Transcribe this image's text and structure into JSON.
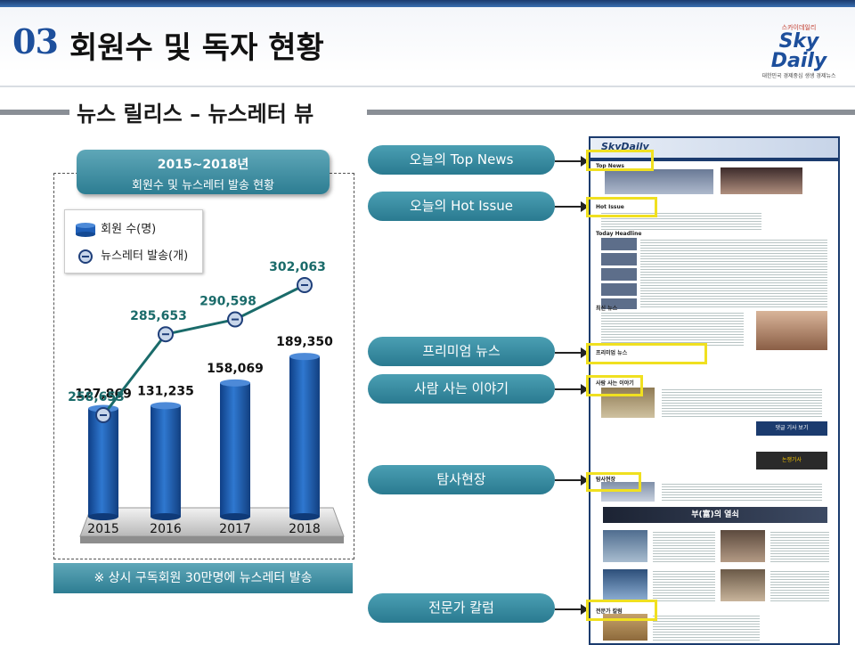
{
  "header": {
    "section_number": "03",
    "title": "회원수 및 독자 현황",
    "logo": {
      "small_text": "스카이데일리",
      "brand": "Sky Daily",
      "tagline": "대한민국 경제중심 생생 경제뉴스"
    }
  },
  "subtitle": "뉴스 릴리스 – 뉴스레터 뷰",
  "chart_panel": {
    "head_line1": "2015~2018년",
    "head_line2": "회원수 및 뉴스레터 발송 현황",
    "footnote": "※ 상시 구독회원  30만명에 뉴스레터 발송"
  },
  "chart_data": {
    "type": "bar",
    "categories": [
      "2015",
      "2016",
      "2017",
      "2018"
    ],
    "series": [
      {
        "name": "회원 수(명)",
        "type": "bar",
        "values": [
          127869,
          131235,
          158069,
          189350
        ],
        "labels": [
          "127,869",
          "131,235",
          "158,069",
          "189,350"
        ],
        "color": "#1f5fb8"
      },
      {
        "name": "뉴스레터 발송(개)",
        "type": "line",
        "values": [
          258653,
          285653,
          290598,
          302063
        ],
        "labels": [
          "258,653",
          "285,653",
          "290,598",
          "302,063"
        ],
        "color": "#1a6b6a"
      }
    ],
    "legend_position": "top-left",
    "grid": false,
    "colors": {
      "label_blue": "#1f5fb8",
      "label_teal": "#1a6b6a"
    }
  },
  "callouts": [
    {
      "label": "오늘의 Top News"
    },
    {
      "label": "오늘의  Hot Issue"
    },
    {
      "label": "프리미엄 뉴스"
    },
    {
      "label": "사람 사는 이야기"
    },
    {
      "label": "탐사현장"
    },
    {
      "label": "전문가 칼럼"
    }
  ],
  "newsletter": {
    "brand": "SkyDaily",
    "sections": [
      "Top News",
      "Hot Issue",
      "Today Headline",
      "최신 뉴스",
      "프리미엄 뉴스",
      "사람 사는 이야기",
      "탐사현장",
      "부(富)의 열쇠",
      "전문가 칼럼"
    ],
    "banner_1": "댓글 기사 보기",
    "banner_2": "논쟁기사",
    "colors": {
      "highlight": "#f0e020",
      "navy": "#1b3b6e"
    }
  }
}
